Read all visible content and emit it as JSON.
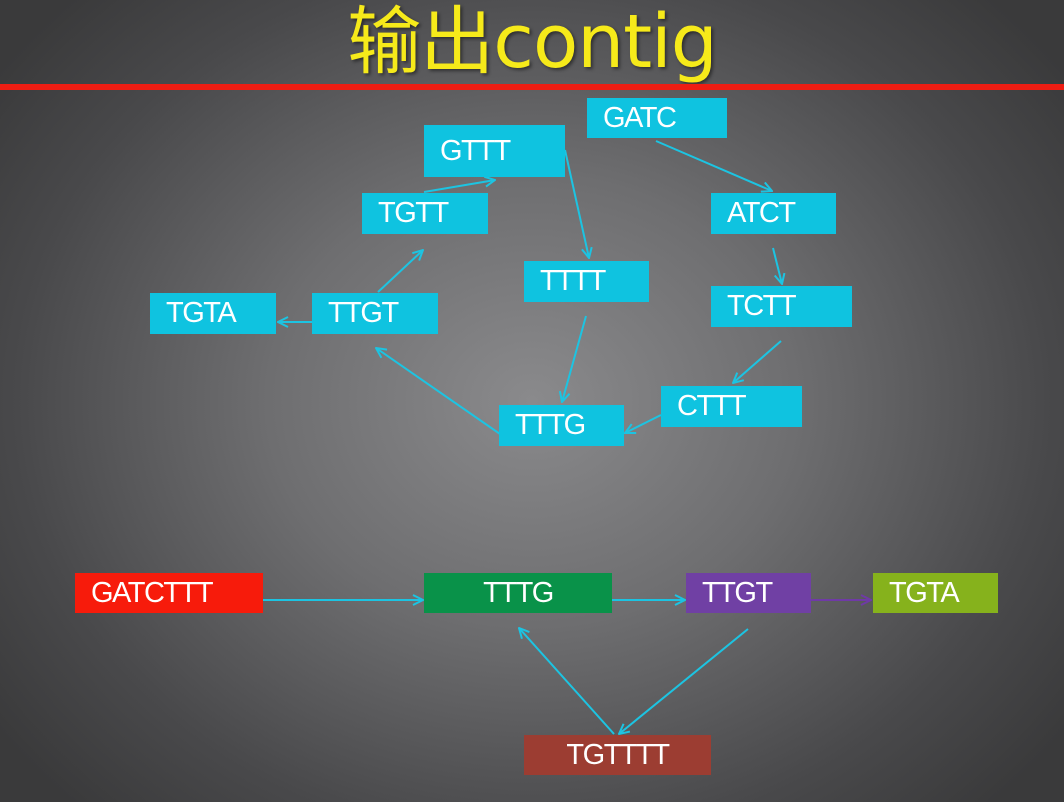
{
  "title": "输出contig",
  "colors": {
    "title": "#f6ea1a",
    "rule": "#ee1d13",
    "node_cyan": "#0fc3e0",
    "edge_cyan": "#1cc4e2",
    "edge_purple": "#6f3aa6",
    "node_red": "#f71b0b",
    "node_green": "#099249",
    "node_purple": "#7040a4",
    "node_lime": "#86b21c",
    "node_brown": "#9c3d32"
  },
  "upper_graph": {
    "nodes": {
      "gatc": "GATC",
      "gttt": "GTTT",
      "tgtt": "TGTT",
      "atct": "ATCT",
      "tttt": "TTTT",
      "tgta": "TGTA",
      "ttgt": "TTGT",
      "tctt": "TCTT",
      "cttt": "CTTT",
      "tttg": "TTTG"
    }
  },
  "contig_graph": {
    "nodes": {
      "gatcttt": "GATCTTT",
      "tttg": "TTTG",
      "ttgt": "TTGT",
      "tgta": "TGTA",
      "tgtttt": "TGTTTT"
    }
  }
}
